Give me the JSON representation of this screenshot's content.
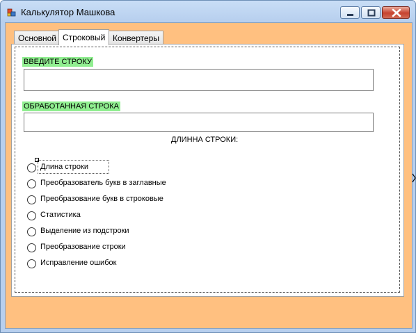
{
  "window": {
    "title": "Калькулятор Машкова"
  },
  "controls": {
    "minimize": "minimize",
    "maximize": "maximize",
    "close": "close"
  },
  "tabs": [
    {
      "label": "Основной",
      "selected": false
    },
    {
      "label": "Строковый",
      "selected": true
    },
    {
      "label": "Конвертеры",
      "selected": false
    }
  ],
  "form": {
    "input_label": "ВВЕДИТЕ СТРОКУ",
    "input_value": "",
    "output_label": "ОБРАБОТАННАЯ СТРОКА",
    "output_value": "",
    "length_label": "ДЛИННА СТРОКИ:"
  },
  "options": [
    {
      "label": "Длина строки",
      "checked": false
    },
    {
      "label": "Преобразователь букв в заглавные",
      "checked": false
    },
    {
      "label": "Преобразование букв в строковые",
      "checked": false
    },
    {
      "label": "Статистика",
      "checked": false
    },
    {
      "label": "Выделение из подстроки",
      "checked": false
    },
    {
      "label": "Преобразование строки",
      "checked": false
    },
    {
      "label": "Исправление ошибок",
      "checked": false
    }
  ],
  "colors": {
    "client_background": "#ffc080",
    "label_highlight": "#90ee90"
  }
}
